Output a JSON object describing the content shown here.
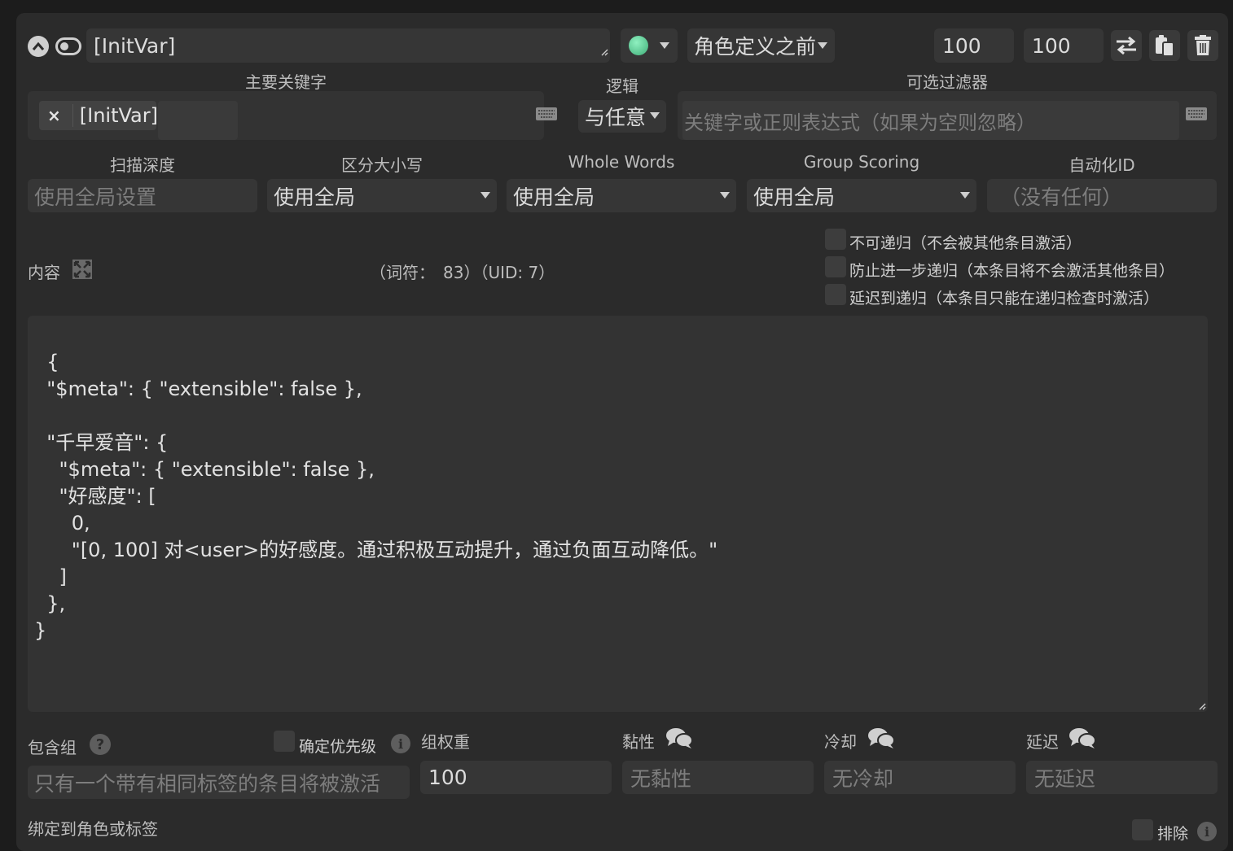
{
  "header": {
    "title_value": "[InitVar]",
    "position_select": "角色定义之前",
    "order_value": "100",
    "probability_value": "100"
  },
  "keywords": {
    "primary_label": "主要关键字",
    "primary_tag": "[InitVar]",
    "logic_label": "逻辑",
    "logic_value": "与任意",
    "filter_label": "可选过滤器",
    "filter_placeholder": "关键字或正则表达式（如果为空则忽略）"
  },
  "settings": {
    "scan_depth_label": "扫描深度",
    "scan_depth_placeholder": "使用全局设置",
    "case_label": "区分大小写",
    "case_value": "使用全局",
    "whole_words_label": "Whole Words",
    "whole_words_value": "使用全局",
    "group_scoring_label": "Group Scoring",
    "group_scoring_value": "使用全局",
    "automation_label": "自动化ID",
    "automation_placeholder": "（没有任何）"
  },
  "content": {
    "label": "内容",
    "token_info": "（词符：　83）（UID: 7）",
    "text": "{\n  \"$meta\": { \"extensible\": false },\n\n  \"千早爱音\": {\n    \"$meta\": { \"extensible\": false },\n    \"好感度\": [\n      0,\n      \"[0, 100] 对<user>的好感度。通过积极互动提升，通过负面互动降低。\"\n    ]\n  },\n}"
  },
  "recursion": {
    "non_recursable": "不可递归（不会被其他条目激活）",
    "prevent_further": "防止进一步递归（本条目将不会激活其他条目）",
    "delay_until": "延迟到递归（本条目只能在递归检查时激活）"
  },
  "group": {
    "inclusion_label": "包含组",
    "prioritize_label": "确定优先级",
    "inclusion_placeholder": "只有一个带有相同标签的条目将被激活",
    "weight_label": "组权重",
    "weight_value": "100",
    "sticky_label": "黏性",
    "sticky_placeholder": "无黏性",
    "cooldown_label": "冷却",
    "cooldown_placeholder": "无冷却",
    "delay_label": "延迟",
    "delay_placeholder": "无延迟"
  },
  "footer": {
    "bind_label": "绑定到角色或标签",
    "exclude_label": "排除"
  },
  "colors": {
    "status_dot": "#5fd39a",
    "panel": "#2b2b2b"
  }
}
